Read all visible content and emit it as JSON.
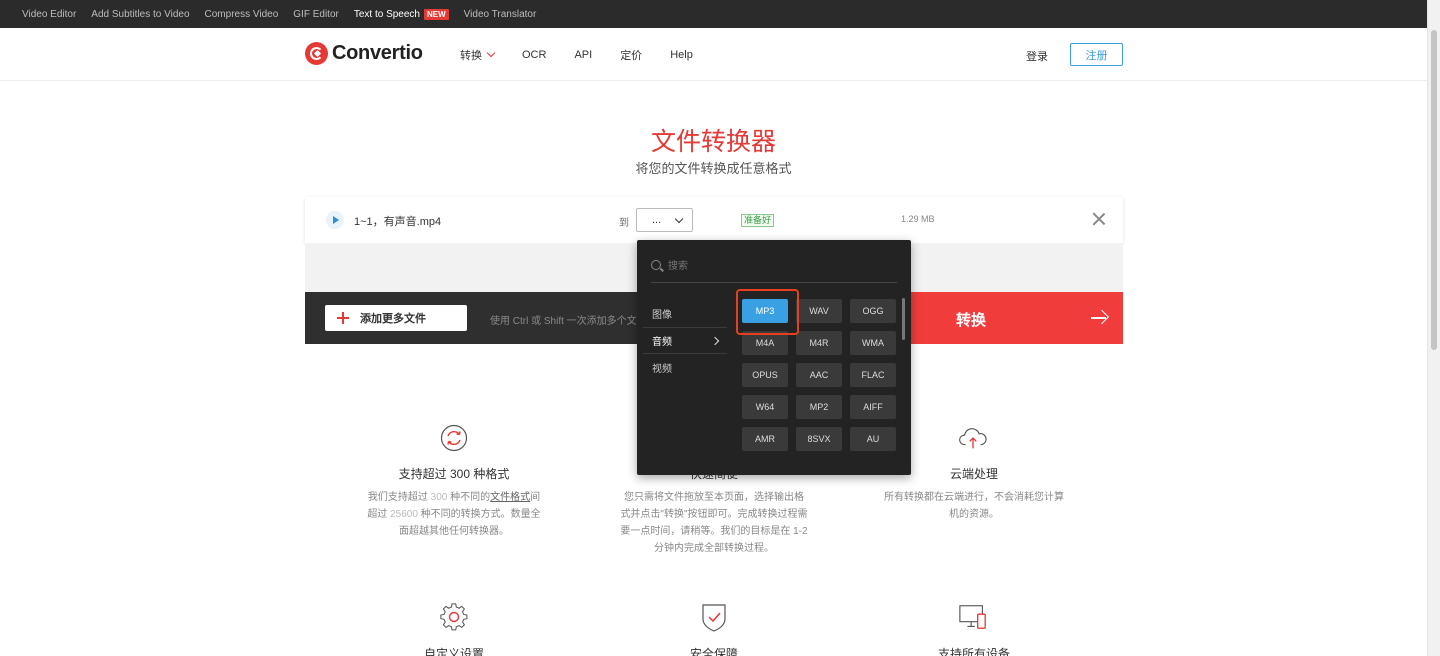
{
  "topbar": {
    "links": [
      "Video Editor",
      "Add Subtitles to Video",
      "Compress Video",
      "GIF Editor",
      "Text to Speech",
      "Video Translator"
    ],
    "new_badge": "NEW"
  },
  "header": {
    "logo": "Convertio",
    "nav": [
      "转换",
      "OCR",
      "API",
      "定价",
      "Help"
    ],
    "login": "登录",
    "signup": "注册"
  },
  "hero": {
    "title": "文件转换器",
    "subtitle": "将您的文件转换成任意格式"
  },
  "file": {
    "name": "1~1，有声音.mp4",
    "to_label": "到",
    "format_value": "...",
    "status": "准备好",
    "size": "1.29 MB"
  },
  "actions": {
    "add_more": "添加更多文件",
    "hint": "使用 Ctrl 或 Shift 一次添加多个文件",
    "convert": "转换"
  },
  "format_panel": {
    "search_placeholder": "搜索",
    "categories": [
      "图像",
      "音频",
      "视频"
    ],
    "selected_category": "音频",
    "formats": [
      "MP3",
      "WAV",
      "OGG",
      "M4A",
      "M4R",
      "WMA",
      "OPUS",
      "AAC",
      "FLAC",
      "W64",
      "MP2",
      "AIFF",
      "AMR",
      "8SVX",
      "AU"
    ],
    "selected_format": "MP3"
  },
  "features": [
    {
      "title": "支持超过 300 种格式",
      "desc_1": "我们支持超过",
      "desc_num1": "300",
      "desc_2": "种不同的",
      "desc_link": "文件格式",
      "desc_3": "间超过",
      "desc_num2": "25600",
      "desc_4": "种不同的转换方式。数量全面超越其他任何转换器。"
    },
    {
      "title": "快速简便",
      "desc": "您只需将文件拖放至本页面，选择输出格式并点击\"转换\"按钮即可。完成转换过程需要一点时间，请稍等。我们的目标是在 1-2 分钟内完成全部转换过程。"
    },
    {
      "title": "云端处理",
      "desc": "所有转换都在云端进行，不会消耗您计算机的资源。"
    },
    {
      "title": "自定义设置"
    },
    {
      "title": "安全保障"
    },
    {
      "title": "支持所有设备"
    }
  ],
  "colors": {
    "brand_red": "#e53935",
    "convert_red": "#f13c3c",
    "accent_blue": "#3aa0e4",
    "panel_bg": "#232323",
    "action_bar": "#2f2f2f"
  }
}
